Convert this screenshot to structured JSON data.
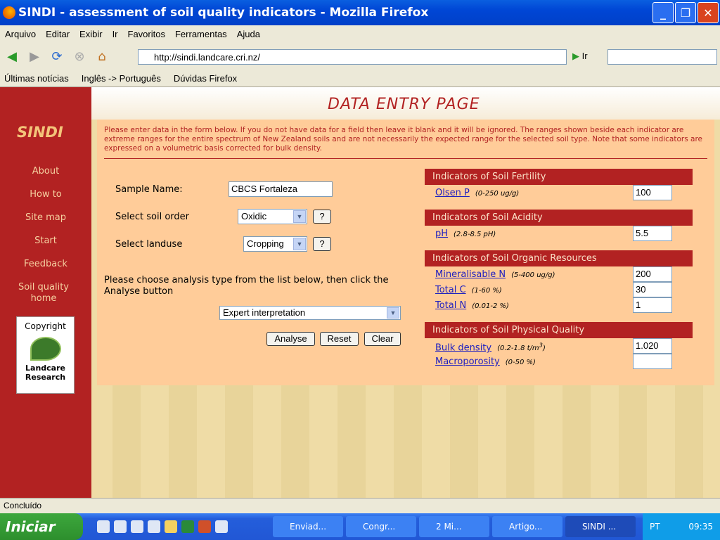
{
  "window": {
    "title": "SINDI - assessment of soil quality indicators - Mozilla Firefox"
  },
  "menu": [
    "Arquivo",
    "Editar",
    "Exibir",
    "Ir",
    "Favoritos",
    "Ferramentas",
    "Ajuda"
  ],
  "nav": {
    "url": "http://sindi.landcare.cri.nz/",
    "go_label": "Ir"
  },
  "bookmarks": [
    "Últimas notícias",
    "Inglês -> Português",
    "Dúvidas Firefox"
  ],
  "sidebar": {
    "logo": "SINDI",
    "items": [
      "About",
      "How to",
      "Site map",
      "Start",
      "Feedback",
      "Soil quality home"
    ],
    "copyright": "Copyright",
    "org": "Landcare Research"
  },
  "page": {
    "title": "DATA ENTRY PAGE",
    "intro": "Please enter data in the form below.   If you do not have data for a field then leave it blank and it will be ignored.   The ranges shown beside each indicator are extreme ranges for the entire spectrum of New Zealand soils and are not necessarily the expected range for the selected soil type.   Note that some indicators are expressed on a volumetric basis corrected for bulk density.",
    "sample_name_label": "Sample Name:",
    "sample_name_value": "CBCS Fortaleza",
    "soil_order_label": "Select soil order",
    "soil_order_value": "Oxidic",
    "landuse_label": "Select landuse",
    "landuse_value": "Cropping",
    "help_label": "?",
    "analysis_prompt": "Please choose analysis type from the list below, then click the Analyse button",
    "analysis_value": "Expert interpretation",
    "buttons": {
      "analyse": "Analyse",
      "reset": "Reset",
      "clear": "Clear"
    },
    "sections": [
      {
        "title": "Indicators of Soil Fertility",
        "items": [
          {
            "name": "Olsen P",
            "range": "(0-250 ug/g)",
            "value": "100"
          }
        ]
      },
      {
        "title": "Indicators of Soil Acidity",
        "items": [
          {
            "name": "pH",
            "range": "(2.8-8.5 pH)",
            "value": "5.5"
          }
        ]
      },
      {
        "title": "Indicators of Soil Organic Resources",
        "items": [
          {
            "name": "Mineralisable N",
            "range": "(5-400 ug/g)",
            "value": "200"
          },
          {
            "name": "Total C",
            "range": "(1-60 %)",
            "value": "30"
          },
          {
            "name": "Total N",
            "range": "(0.01-2 %)",
            "value": "1"
          }
        ]
      },
      {
        "title": "Indicators of Soil Physical Quality",
        "items": [
          {
            "name": "Bulk density",
            "range": "(0.2-1.8 t/m",
            "range_sup": "3",
            "range_end": ")",
            "value": "1.020"
          },
          {
            "name": "Macroporosity",
            "range": "(0-50 %)",
            "value": ""
          }
        ]
      }
    ]
  },
  "status": "Concluído",
  "taskbar": {
    "start": "Iniciar",
    "tasks": [
      "Enviad...",
      "Congr...",
      "2 Mi...",
      "Artigo...",
      "SINDI ..."
    ],
    "lang": "PT",
    "clock": "09:35"
  }
}
